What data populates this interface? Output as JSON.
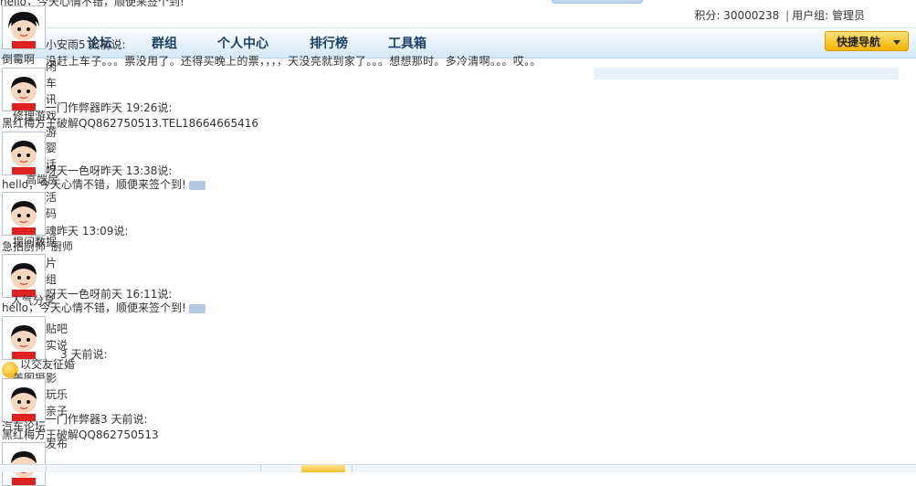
{
  "top": {
    "cut_text": "hello，今天心情不错，顺便来签个到!",
    "user_score": "积分: 30000238",
    "user_group": "用户组: 管理员",
    "sep": "|"
  },
  "nav": {
    "items": [
      {
        "label": "论坛"
      },
      {
        "label": "群组"
      },
      {
        "label": "个人中心"
      },
      {
        "label": "排行榜"
      },
      {
        "label": "工具箱"
      }
    ],
    "quick_nav": "快捷导航"
  },
  "overlay_labels": [
    "闲",
    "车",
    "讯",
    "游",
    "婴",
    "话",
    "活",
    "码",
    "片",
    "组",
    "贴吧",
    "实说",
    "玩乐",
    "亲子",
    "发布",
    "厨师"
  ],
  "feed": [
    {
      "header": "小安雨5 天前说:",
      "content": "没赶上车子。。。票没用了。还得买晚上的票，，，，天没亮就到家了。。。想想那时。多冷清啊。。。哎。。",
      "side": "倒霉啊"
    },
    {
      "header": "一门作弊器昨天 19:26说:",
      "content": "黑红梅方王破解QQ862750513.TEL18664665416",
      "side": "修理游戏"
    },
    {
      "header": "呀天一色呀昨天 13:38说:",
      "content": "hello，今天心情不错，顺便来签个到!",
      "side": "高端房"
    },
    {
      "header": "魂昨天 13:09说:",
      "content": "急招厨师",
      "side": "提问数据"
    },
    {
      "header": "呀天一色呀前天 16:11说:",
      "content": "hello，今天心情不错，顺便来签个到!",
      "side": "人气分享"
    },
    {
      "header": "3 天前说:",
      "content": "以交友征婚",
      "side": "美图摄影"
    },
    {
      "header": "一门作弊器3 天前说:",
      "content": "黑红梅方王破解QQ862750513",
      "side": "汽车论坛"
    }
  ]
}
